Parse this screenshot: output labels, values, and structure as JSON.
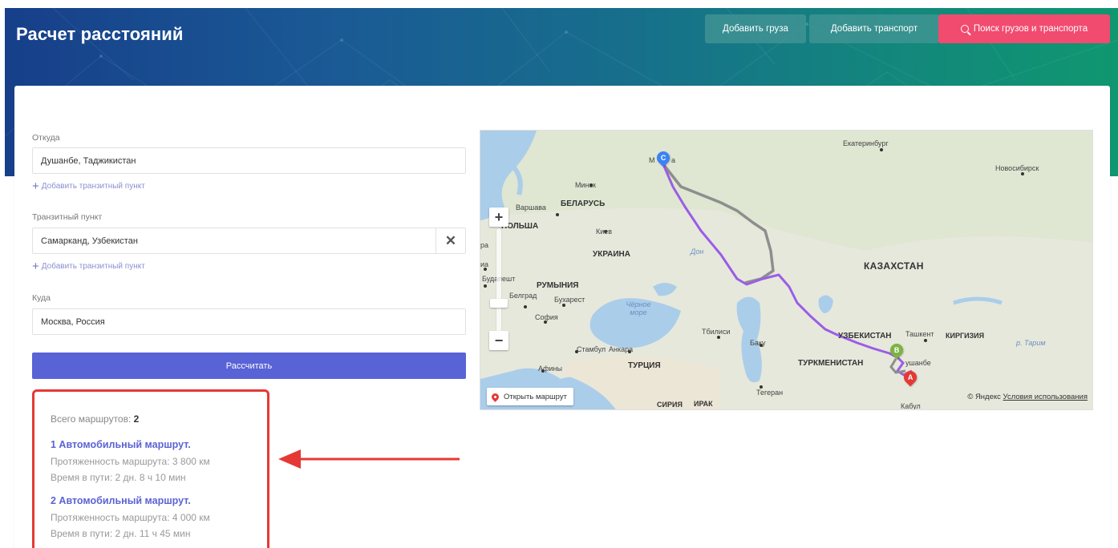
{
  "page": {
    "title": "Расчет расстояний"
  },
  "header": {
    "add_cargo": "Добавить груза",
    "add_transport": "Добавить транспорт",
    "search": "Поиск грузов и транспорта"
  },
  "form": {
    "from_label": "Откуда",
    "from_value": "Душанбе, Таджикистан",
    "add_transit_1": "Добавить транзитный пункт",
    "transit_label": "Транзитный пункт",
    "transit_value": "Самарканд, Узбекистан",
    "add_transit_2": "Добавить транзитный пункт",
    "to_label": "Куда",
    "to_value": "Москва, Россия",
    "calculate": "Рассчитать"
  },
  "results": {
    "total_label": "Всего маршрутов:",
    "total_value": "2",
    "routes": [
      {
        "title": "1 Автомобильный маршрут.",
        "length": "Протяженность маршрута: 3 800 км",
        "time": "Время в пути: 2 дн. 8 ч 10 мин"
      },
      {
        "title": "2 Автомобильный маршрут.",
        "length": "Протяженность маршрута: 4 000 км",
        "time": "Время в пути: 2 дн. 11 ч 45 мин"
      }
    ]
  },
  "map": {
    "labels": {
      "ekaterinburg": "Екатеринбург",
      "novosibirsk": "Новосибирск",
      "moscow_partial": "М",
      "moscow_partial2": "а",
      "minsk": "Минск",
      "warsaw": "Варшава",
      "belarus": "БЕЛАРУСЬ",
      "poland": "ПОЛЬША",
      "kiev": "Киев",
      "ukraine": "УКРАИНА",
      "don": "Дон",
      "kazakhstan": "КАЗАХСТАН",
      "budapest": "Будапешт",
      "romania": "РУМЫНИЯ",
      "belgrade": "Белград",
      "bucharest": "Бухарест",
      "black_sea": "Чёрное море",
      "sofia": "София",
      "tbilisi": "Тбилиси",
      "baku": "Баку",
      "uzbekistan": "УЗБЕКИСТАН",
      "tashkent": "Ташкент",
      "kyrgyzstan": "КИРГИЗИЯ",
      "tarim": "р. Тарим",
      "istanbul": "Стамбул",
      "ankara": "Анкара",
      "turkey": "ТУРЦИЯ",
      "turkmenistan": "ТУРКМЕНИСТАН",
      "dushanbe_partial": "ушанбе",
      "athens": "Афины",
      "tehran": "Тегеран",
      "syria": "СИРИЯ",
      "iraq": "ИРАК",
      "kabul": "Кабул",
      "ra": "ра",
      "ia": "иа"
    },
    "open_route": "Открыть маршрут",
    "copyright": "© Яндекс",
    "terms": "Условия использования",
    "markers": {
      "a": "A",
      "b": "B",
      "c": "C"
    },
    "colors": {
      "route_main": "#9b5de5",
      "route_alt": "#8e8e8e",
      "marker_a": "#e53935",
      "marker_b": "#7cb342",
      "marker_c": "#3b82f6"
    }
  }
}
